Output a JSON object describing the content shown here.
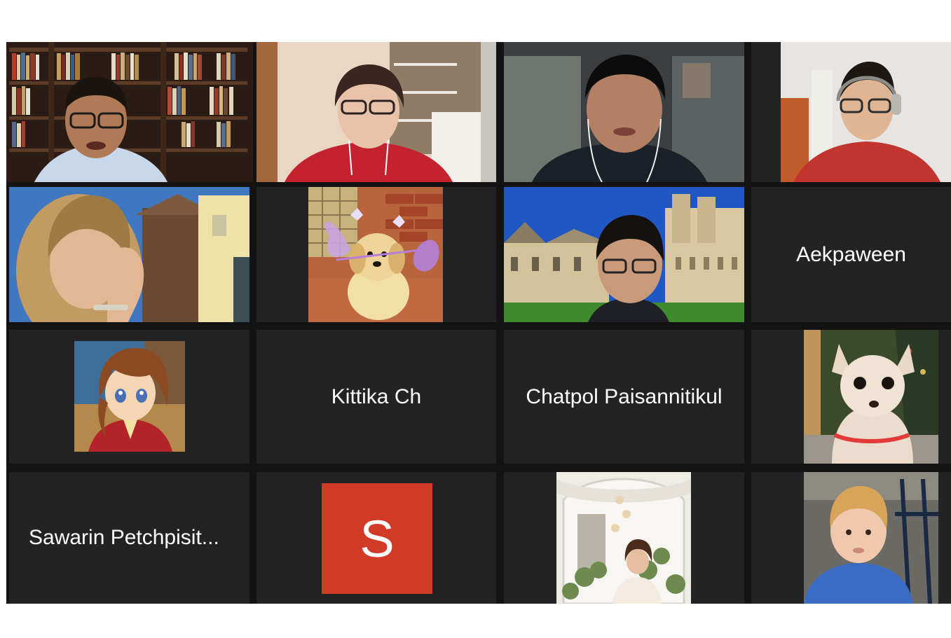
{
  "participants": [
    {
      "id": "p1",
      "video": "man-glasses-bookshelf",
      "active_speaker": true
    },
    {
      "id": "p2",
      "video": "woman-glasses-red-shirt"
    },
    {
      "id": "p3",
      "video": "young-man-earphones"
    },
    {
      "id": "p4",
      "video": "man-glasses-headphones-red-shirt"
    },
    {
      "id": "p5",
      "video": "woman-hand-on-cheek-outdoor"
    },
    {
      "id": "p6",
      "profile_picture": "puppy-with-fairy-wings"
    },
    {
      "id": "p7",
      "video": "young-man-glasses-castle-background"
    },
    {
      "id": "p8",
      "name": "Aekpaween"
    },
    {
      "id": "p9",
      "profile_picture": "anime-girl"
    },
    {
      "id": "p10",
      "name": "Kittika Ch"
    },
    {
      "id": "p11",
      "name": "Chatpol Paisannitikul"
    },
    {
      "id": "p12",
      "profile_picture": "white-chihuahua"
    },
    {
      "id": "p13",
      "name": "Sawarin Petchpisit..."
    },
    {
      "id": "p14",
      "avatar_initial": "S",
      "avatar_color": "#d13a27"
    },
    {
      "id": "p15",
      "profile_picture": "woman-white-arch-flowers"
    },
    {
      "id": "p16",
      "profile_picture": "blond-toddler"
    }
  ],
  "colors": {
    "tile_bg": "#232323",
    "gap": "#131313",
    "active_speaker_border": "#c8ef3c",
    "name_text": "#ffffff"
  }
}
